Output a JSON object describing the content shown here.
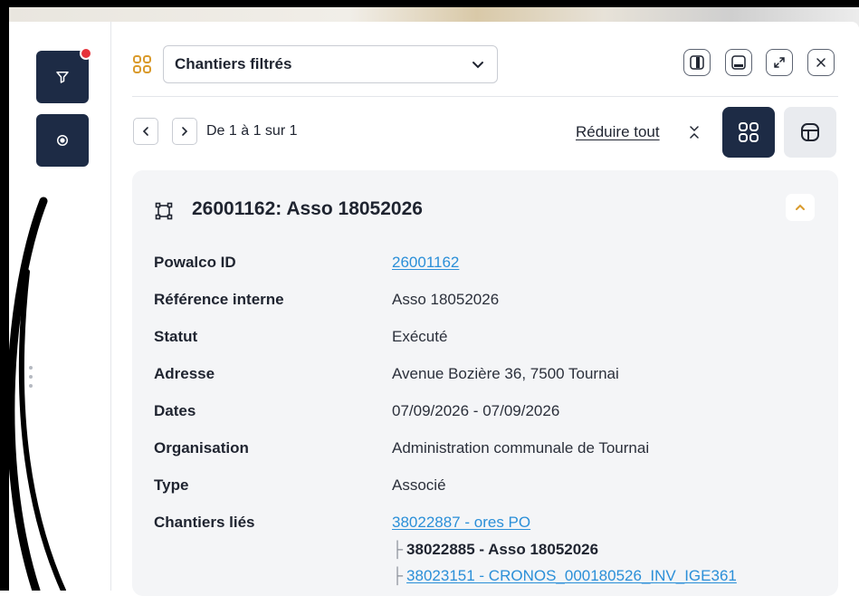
{
  "sidebar": {
    "buttons": [
      {
        "name": "filter",
        "icon": "filter-icon",
        "has_badge": true
      },
      {
        "name": "settings",
        "icon": "target-icon",
        "has_badge": false
      }
    ]
  },
  "header": {
    "selector_value": "Chantiers filtrés",
    "window_controls": [
      "split-vertical-icon",
      "minimize-icon",
      "expand-icon",
      "close-icon"
    ]
  },
  "toolbar": {
    "pagination_text": "De 1 à 1 sur 1",
    "collapse_all_label": "Réduire tout"
  },
  "card": {
    "title": "26001162: Asso 18052026",
    "fields": [
      {
        "label": "Powalco ID",
        "value": "26001162",
        "link": true
      },
      {
        "label": "Référence interne",
        "value": "Asso 18052026",
        "link": false
      },
      {
        "label": "Statut",
        "value": "Exécuté",
        "link": false
      },
      {
        "label": "Adresse",
        "value": "Avenue Bozière 36, 7500 Tournai",
        "link": false
      },
      {
        "label": "Dates",
        "value": "07/09/2026 - 07/09/2026",
        "link": false
      },
      {
        "label": "Organisation",
        "value": "Administration communale de Tournai",
        "link": false
      },
      {
        "label": "Type",
        "value": "Associé",
        "link": false
      },
      {
        "label": "Chantiers liés",
        "value": "38022887 - ores PO",
        "link": true
      }
    ],
    "linked_children": [
      {
        "text": "38022885 - Asso 18052026",
        "current": true
      },
      {
        "text": "38023151 - CRONOS_000180526_INV_IGE361",
        "current": false
      }
    ]
  },
  "colors": {
    "navy": "#1d2b45",
    "link": "#2b8fd8",
    "badge": "#e5333b",
    "accent_icon": "#d99a2b"
  }
}
